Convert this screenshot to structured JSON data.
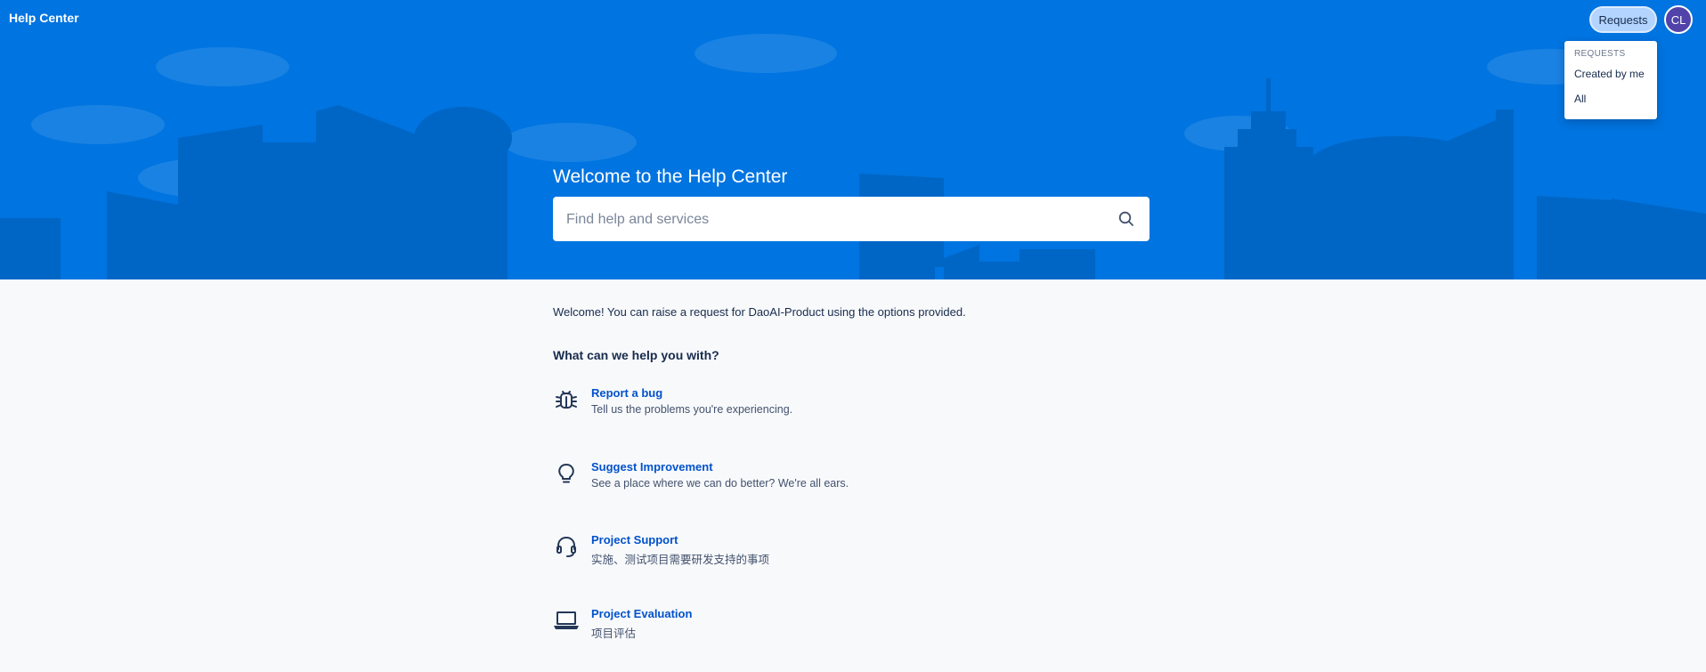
{
  "header": {
    "brand": "Help Center",
    "requests_button": "Requests",
    "avatar_initials": "CL"
  },
  "requests_menu": {
    "heading": "REQUESTS",
    "items": [
      "Created by me",
      "All"
    ]
  },
  "hero": {
    "title": "Welcome to the Help Center",
    "search_placeholder": "Find help and services"
  },
  "main": {
    "intro": "Welcome! You can raise a request for DaoAI-Product using the options provided.",
    "section_title": "What can we help you with?",
    "request_types": [
      {
        "name": "Report a bug",
        "description": "Tell us the problems you're experiencing.",
        "icon": "bug-icon"
      },
      {
        "name": "Suggest Improvement",
        "description": "See a place where we can do better? We're all ears.",
        "icon": "lightbulb-icon"
      },
      {
        "name": "Project Support",
        "description": "实施、测试项目需要研发支持的事项",
        "icon": "headset-icon"
      },
      {
        "name": "Project Evaluation",
        "description": "项目评估",
        "icon": "laptop-icon"
      }
    ]
  },
  "colors": {
    "banner": "#0074e0",
    "link": "#0052cc",
    "avatar": "#5243aa"
  }
}
